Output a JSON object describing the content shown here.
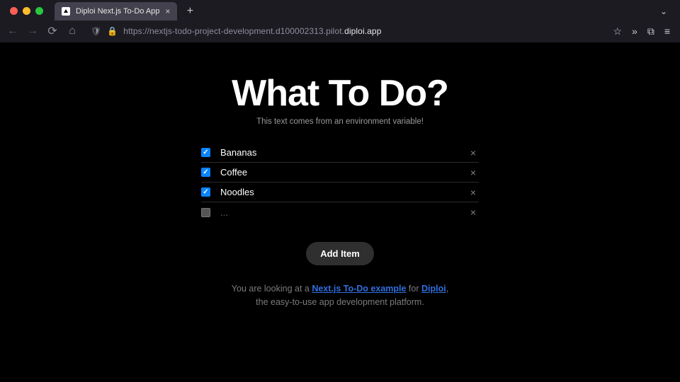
{
  "browser": {
    "tab_title": "Diploi Next.js To-Do App",
    "url_dim": "https://nextjs-todo-project-development.d100002313.pilot.",
    "url_strong": "diploi.app"
  },
  "page": {
    "title": "What To Do?",
    "subtitle": "This text comes from an environment variable!",
    "add_button": "Add Item",
    "new_item_placeholder": "..."
  },
  "items": [
    {
      "label": "Bananas",
      "checked": true
    },
    {
      "label": "Coffee",
      "checked": true
    },
    {
      "label": "Noodles",
      "checked": true
    }
  ],
  "footer": {
    "pre": "You are looking at a ",
    "link1": "Next.js To-Do example",
    "mid": " for ",
    "link2": "Diploi",
    "post": ",",
    "line2": "the easy-to-use app development platform."
  }
}
